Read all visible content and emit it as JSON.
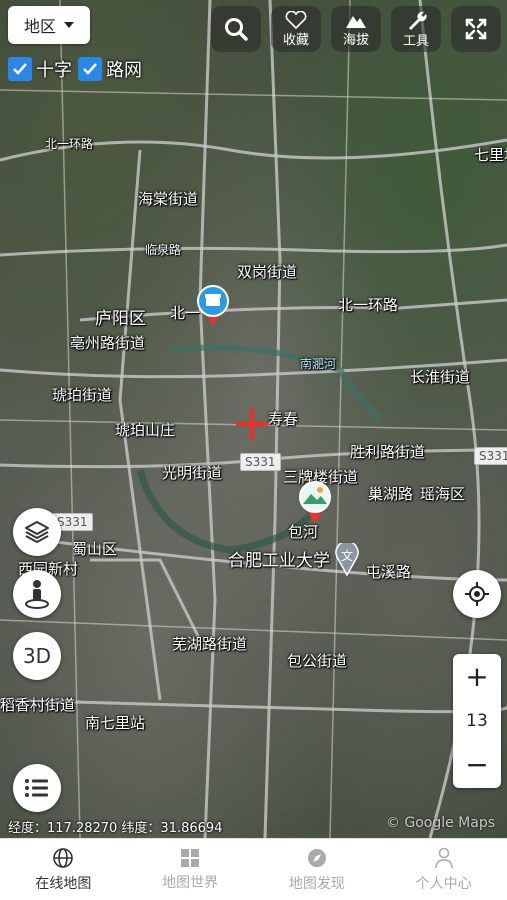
{
  "region_selector": {
    "label": "地区"
  },
  "toolbar": {
    "search_icon": "search-icon",
    "favorite_label": "收藏",
    "elevation_label": "海拔",
    "tools_label": "工具",
    "fullscreen_icon": "fullscreen-icon"
  },
  "toggles": [
    {
      "label": "十字",
      "checked": true
    },
    {
      "label": "路网",
      "checked": true
    }
  ],
  "map_labels": {
    "beiyi_huanlu": "北一环路",
    "qiliwei": "七里圩",
    "haitang": "海棠街道",
    "linquan_lu": "临泉路",
    "shuanggang": "双岗街道",
    "beiyi_huanlu_2": "北一环路",
    "luyang": "庐阳区",
    "bei_yi": "北一",
    "bozhou_lu": "亳州路街道",
    "nanfei_he": "南淝河",
    "changhuai": "长淮街道",
    "hupo": "琥珀街道",
    "hupo_shanzhuang": "琥珀山庄",
    "shouchun": "寿春",
    "shengli_lu": "胜利路街道",
    "guangming": "光明街道",
    "sanxiaoqiao": "三牌楼街道",
    "chaohu_lu": "巢湖路",
    "yaohai": "瑶海区",
    "baohe": "包河",
    "shushan": "蜀山区",
    "xiyuan": "西园新村",
    "hefei_gongye": "合肥工业大学",
    "tunxi_lu": "屯溪路",
    "wuhu_lu": "芜湖路街道",
    "baogong": "包公街道",
    "daoxiang": "稻香村街道",
    "nanqili": "南七里站",
    "s331_a": "S331",
    "s331_b": "S331",
    "s331_c": "S331"
  },
  "float_buttons": {
    "layers_icon": "layers-icon",
    "street_view_icon": "street-view-icon",
    "three_d_label": "3D",
    "list_icon": "list-icon"
  },
  "zoom": {
    "plus": "+",
    "level": "13",
    "minus": "−"
  },
  "coordinates": {
    "text": "经度：117.28270 纬度：31.86694"
  },
  "attribution": "© Google Maps",
  "nav": [
    {
      "label": "在线地图",
      "icon": "globe-icon",
      "active": true
    },
    {
      "label": "地图世界",
      "icon": "grid-icon",
      "active": false
    },
    {
      "label": "地图发现",
      "icon": "compass-icon",
      "active": false
    },
    {
      "label": "个人中心",
      "icon": "person-icon",
      "active": false
    }
  ],
  "colors": {
    "accent": "#2b87e6",
    "crosshair": "#e8322b",
    "nav_active": "#333333",
    "nav_inactive": "#aaaaaa"
  }
}
